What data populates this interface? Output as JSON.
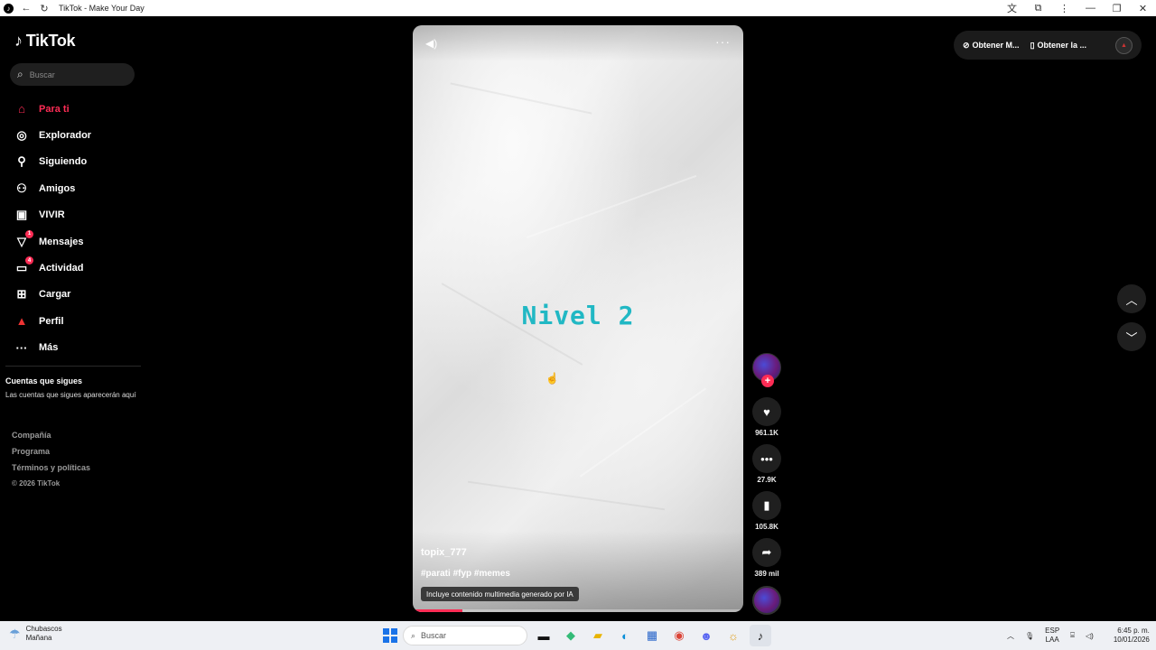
{
  "browser": {
    "title": "TikTok - Make Your Day"
  },
  "sidebar": {
    "logo": "TikTok",
    "search_placeholder": "Buscar",
    "items": [
      {
        "label": "Para ti",
        "icon": "home-icon",
        "active": true
      },
      {
        "label": "Explorador",
        "icon": "compass-icon"
      },
      {
        "label": "Siguiendo",
        "icon": "following-icon"
      },
      {
        "label": "Amigos",
        "icon": "friends-icon"
      },
      {
        "label": "VIVIR",
        "icon": "live-tv-icon"
      },
      {
        "label": "Mensajes",
        "icon": "messages-icon",
        "badge": "1"
      },
      {
        "label": "Actividad",
        "icon": "activity-icon",
        "badge": "4"
      },
      {
        "label": "Cargar",
        "icon": "upload-icon"
      },
      {
        "label": "Perfil",
        "icon": "profile-avatar-icon"
      },
      {
        "label": "Más",
        "icon": "more-dots-icon"
      }
    ],
    "following_title": "Cuentas que sigues",
    "following_text": "Las cuentas que sigues aparecerán aquí",
    "footer": {
      "company": "Compañía",
      "program": "Programa",
      "terms": "Términos y políticas",
      "copyright": "© 2026 TikTok"
    }
  },
  "video": {
    "overlay_text": "Nivel 2",
    "author": "topix_777",
    "hashtags": "#parati #fyp #memes",
    "ai_label": "Incluye contenido multimedia generado por IA",
    "progress_fraction": 0.15
  },
  "actions": {
    "likes": "961.1K",
    "comments": "27.9K",
    "saves": "105.8K",
    "shares": "389 mil"
  },
  "top_right": {
    "get_coins": "Obtener M...",
    "get_app": "Obtener la ..."
  },
  "taskbar": {
    "weather_title": "Chubascos",
    "weather_sub": "Mañana",
    "search_placeholder": "Buscar",
    "lang_top": "ESP",
    "lang_bottom": "LAA",
    "time": "6:45 p. m.",
    "date": "10/01/2026"
  },
  "colors": {
    "accent": "#fe2c55",
    "overlay_text": "#21b8c4"
  }
}
